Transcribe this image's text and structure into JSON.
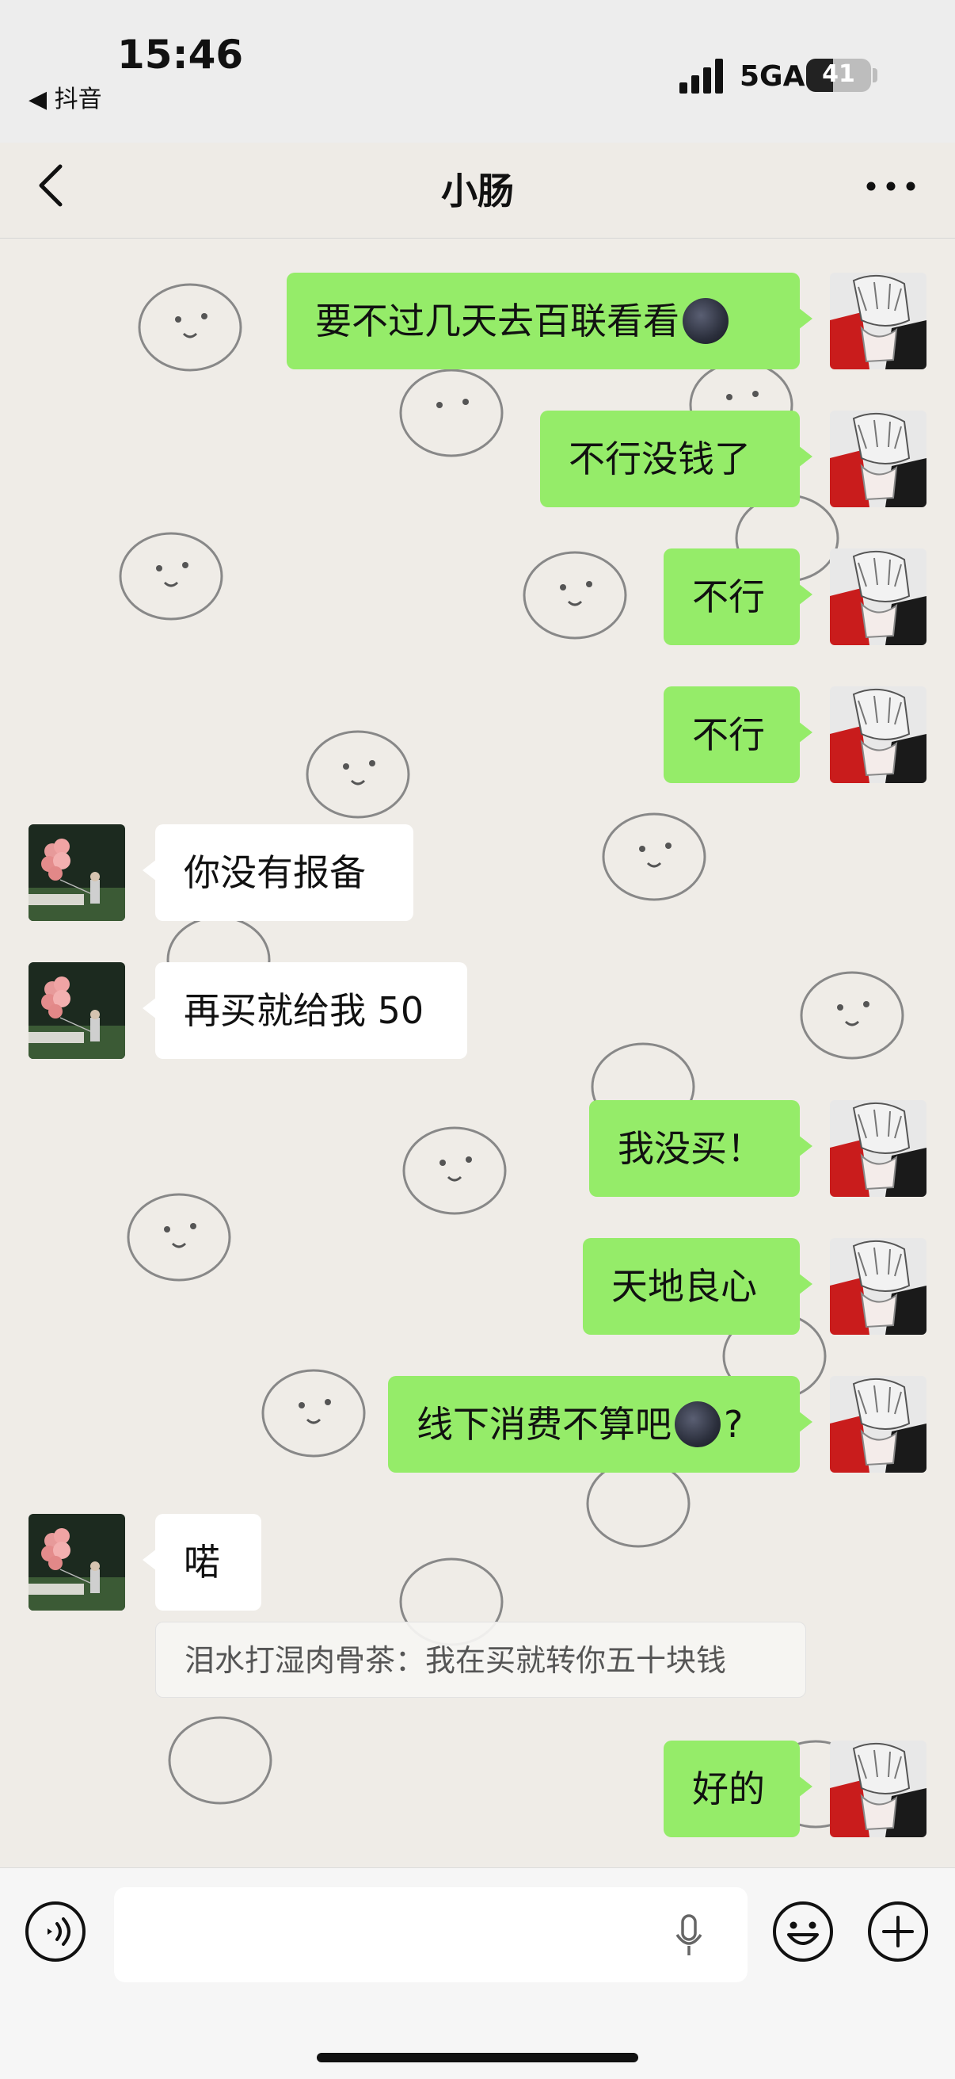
{
  "status_bar": {
    "time": "15:46",
    "back_app": "◀ 抖音",
    "network": "5GA",
    "battery_level": 41,
    "battery_text": "41"
  },
  "nav": {
    "title": "小肠",
    "back_icon": "chevron-left-icon",
    "more_icon": "more-dots-icon"
  },
  "messages": [
    {
      "side": "mine",
      "text": "要不过几天去百联看看",
      "emoji": "new-moon-face"
    },
    {
      "side": "mine",
      "text": "不行没钱了"
    },
    {
      "side": "mine",
      "text": "不行"
    },
    {
      "side": "mine",
      "text": "不行"
    },
    {
      "side": "theirs",
      "text": "你没有报备"
    },
    {
      "side": "theirs",
      "text": "再买就给我 50"
    },
    {
      "side": "mine",
      "text": "我没买！"
    },
    {
      "side": "mine",
      "text": "天地良心"
    },
    {
      "side": "mine",
      "text": "线下消费不算吧",
      "emoji": "new-moon-face",
      "suffix": "?"
    },
    {
      "side": "theirs",
      "text": "喏"
    },
    {
      "side": "mine",
      "text": "好的"
    }
  ],
  "quote": {
    "text": "泪水打湿肉骨茶：我在买就转你五十块钱"
  },
  "input_bar": {
    "placeholder": "",
    "voice_icon": "voice-icon",
    "mic_icon": "microphone-icon",
    "emoji_icon": "emoji-icon",
    "plus_icon": "plus-icon"
  },
  "colors": {
    "mine_bubble": "#95ec69",
    "theirs_bubble": "#ffffff",
    "chat_bg": "#efece7"
  }
}
